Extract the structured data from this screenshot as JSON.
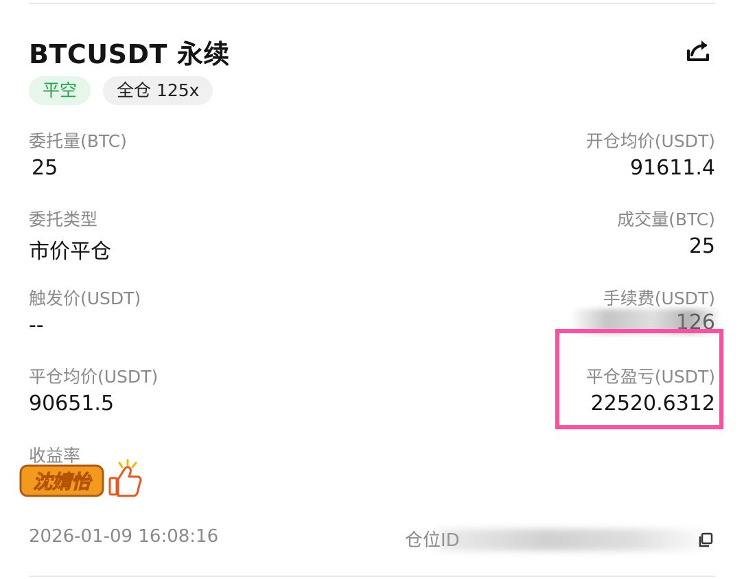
{
  "header": {
    "title": "BTCUSDT 永续",
    "share_icon": "share-icon"
  },
  "tags": {
    "side": "平空",
    "margin_mode": "全仓 125x"
  },
  "fields": {
    "order_qty_label": "委托量(BTC)",
    "order_qty_value": "25",
    "open_avg_price_label": "开仓均价(USDT)",
    "open_avg_price_value": "91611.4",
    "order_type_label": "委托类型",
    "order_type_value": "市价平仓",
    "filled_qty_label": "成交量(BTC)",
    "filled_qty_value": "25",
    "trigger_price_label": "触发价(USDT)",
    "trigger_price_value": "--",
    "fee_label": "手续费(USDT)",
    "fee_value_visible": "126",
    "close_avg_price_label": "平仓均价(USDT)",
    "close_avg_price_value": "90651.5",
    "close_pnl_label": "平仓盈亏(USDT)",
    "close_pnl_value": "22520.6312",
    "roi_label": "收益率"
  },
  "sticker": {
    "text": "沈婧怡"
  },
  "footer": {
    "timestamp": "2026-01-09 16:08:16",
    "position_id_label": "仓位ID",
    "copy_icon": "copy-icon"
  },
  "colors": {
    "green_tag_text": "#25a449",
    "green_tag_bg": "#e6f6ea",
    "highlight": "#ff4fa3",
    "label_grey": "#8a8a8a"
  }
}
